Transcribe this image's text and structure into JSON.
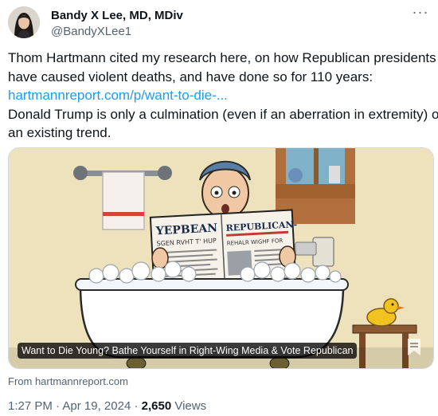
{
  "author": {
    "display_name": "Bandy X Lee, MD, MDiv",
    "handle": "@BandyXLee1"
  },
  "more_icon": "more-horizontal-icon",
  "tweet": {
    "line1": "Thom Hartmann cited my research here, on how Republican presidents",
    "line2": "have caused violent deaths, and have done so for 110 years:",
    "link": "hartmannreport.com/p/want-to-die-...",
    "line4": "Donald Trump is only a culmination (even if an aberration in extremity) of",
    "line5": "an existing trend."
  },
  "card": {
    "caption": "Want to Die Young? Bathe Yourself in Right-Wing Media & Vote Republican",
    "source": "From hartmannreport.com",
    "image_icon": "bookmark-icon",
    "newspaper_left_headline": "YEPBEAN",
    "newspaper_left_sub": "SGEN RVHT T' HUP",
    "newspaper_right_headline": "REPUBLICAN-",
    "newspaper_right_sub": "REHALR WIGHF FOR"
  },
  "meta": {
    "time": "1:27 PM",
    "separator": "·",
    "date": "Apr 19, 2024",
    "views_count": "2,650",
    "views_label": "Views"
  }
}
